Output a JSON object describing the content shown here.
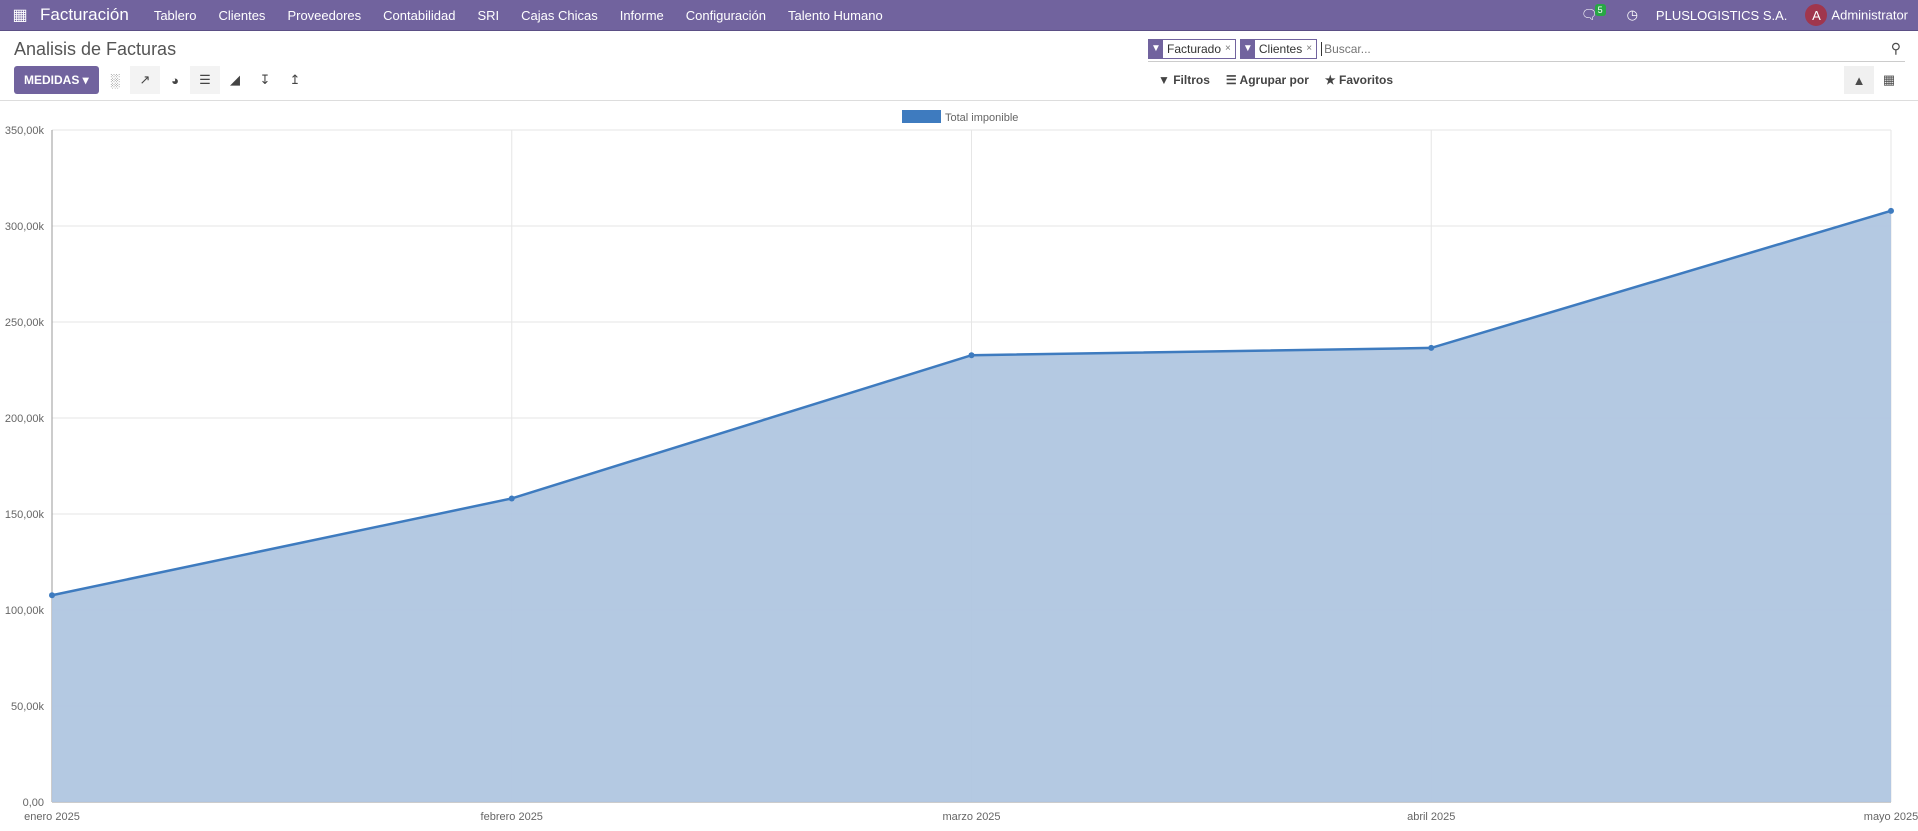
{
  "nav": {
    "app": "Facturación",
    "menus": [
      "Tablero",
      "Clientes",
      "Proveedores",
      "Contabilidad",
      "SRI",
      "Cajas Chicas",
      "Informe",
      "Configuración",
      "Talento Humano"
    ],
    "messages_count": "5",
    "company": "PLUSLOGISTICS S.A.",
    "user_initial": "A",
    "user": "Administrator"
  },
  "page": {
    "title": "Analisis de Facturas",
    "measures_label": "MEDIDAS"
  },
  "search": {
    "facets": [
      "Facturado",
      "Clientes"
    ],
    "placeholder": "Buscar..."
  },
  "options": {
    "filters": "Filtros",
    "group_by": "Agrupar por",
    "favorites": "Favoritos"
  },
  "colors": {
    "accent": "#71639e",
    "series": "#3e7bbf",
    "fill": "#b0c6e0"
  },
  "chart_data": {
    "type": "area",
    "title": "",
    "xlabel": "",
    "ylabel": "",
    "legend": "top-center",
    "grid": true,
    "categories": [
      "enero 2025",
      "febrero 2025",
      "marzo 2025",
      "abril 2025",
      "mayo 2025"
    ],
    "series": [
      {
        "name": "Total imponible",
        "values": [
          107700,
          158100,
          232700,
          236500,
          307900
        ]
      }
    ],
    "ylim": [
      0,
      350000
    ],
    "yticks": [
      "0,00",
      "50,00k",
      "100,00k",
      "150,00k",
      "200,00k",
      "250,00k",
      "300,00k",
      "350,00k"
    ]
  }
}
